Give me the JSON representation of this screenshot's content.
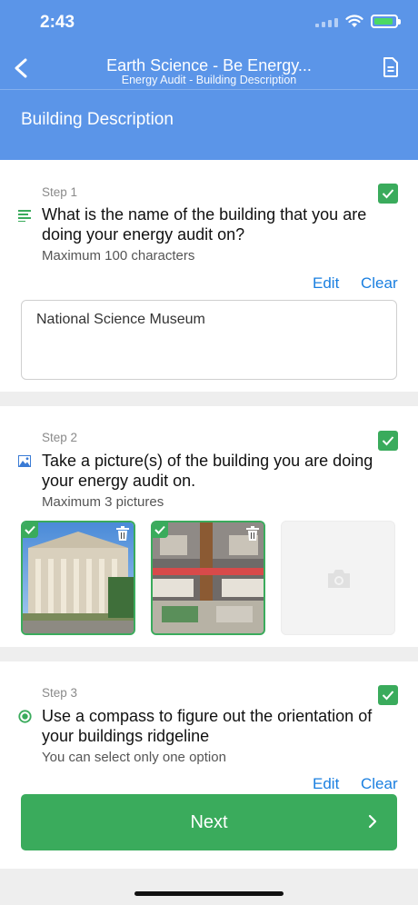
{
  "status": {
    "time": "2:43"
  },
  "nav": {
    "title": "Earth Science - Be Energy...",
    "subtitle": "Energy Audit - Building Description",
    "back_icon": "chevron-left-icon",
    "doc_icon": "document-icon"
  },
  "page": {
    "heading": "Building Description"
  },
  "steps": [
    {
      "label": "Step 1",
      "question": "What is the name of the building that you are doing your energy audit on?",
      "hint": "Maximum 100 characters",
      "edit": "Edit",
      "clear": "Clear",
      "answer": "National Science Museum",
      "icon": "text-lines-icon"
    },
    {
      "label": "Step 2",
      "question": "Take a picture(s) of the building you are doing your energy audit on.",
      "hint": "Maximum 3 pictures",
      "icon": "image-icon"
    },
    {
      "label": "Step 3",
      "question": "Use a compass to figure out the orientation of your buildings ridgeline",
      "hint": "You can select only one option",
      "edit": "Edit",
      "clear": "Clear",
      "icon": "radio-icon"
    }
  ],
  "footer": {
    "next_label": "Next"
  },
  "colors": {
    "header": "#5b95e8",
    "accent_green": "#3aab5c",
    "link_blue": "#1a7fe0"
  }
}
